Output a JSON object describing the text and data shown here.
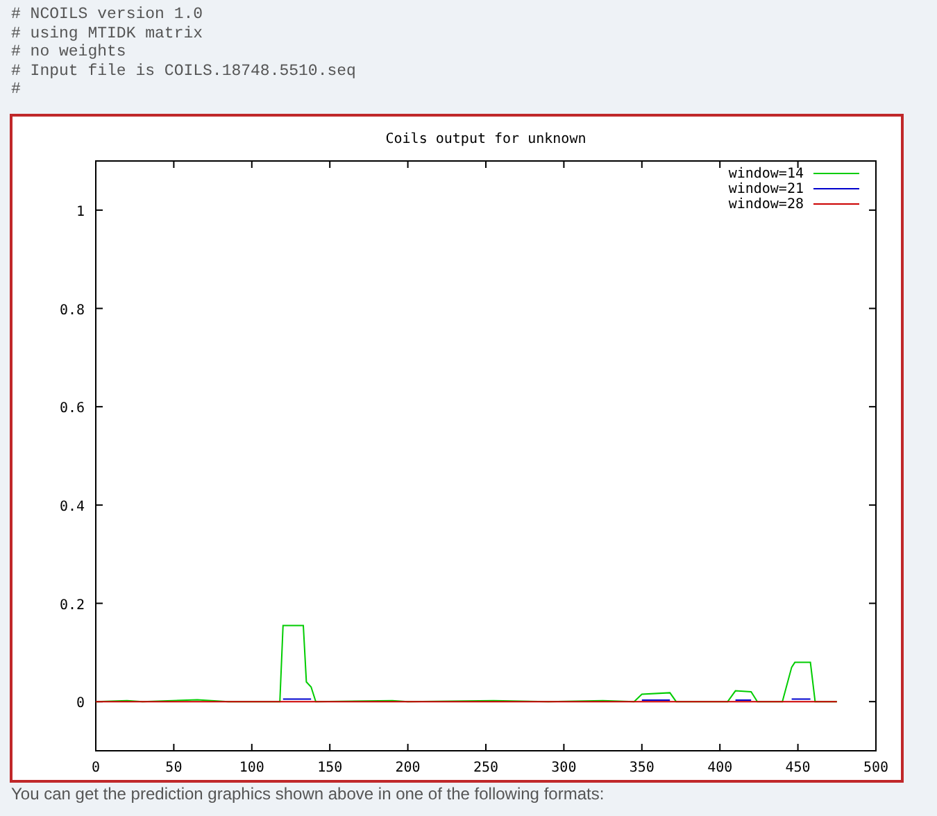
{
  "header_lines": [
    "# NCOILS version 1.0",
    "# using MTIDK matrix",
    "# no weights",
    "# Input file is COILS.18748.5510.seq",
    "#"
  ],
  "chart": {
    "chart_data": {
      "type": "line",
      "title": "Coils output for unknown",
      "x": [
        0,
        20,
        30,
        65,
        85,
        118,
        120,
        123,
        133,
        135,
        138,
        141,
        190,
        200,
        255,
        290,
        325,
        345,
        350,
        368,
        372,
        405,
        410,
        420,
        424,
        440,
        446,
        448,
        458,
        461,
        475
      ],
      "series": [
        {
          "name": "window=14",
          "color": "#00cc00",
          "values": [
            0,
            0.002,
            0,
            0.004,
            0,
            0,
            0.155,
            0.155,
            0.155,
            0.04,
            0.03,
            0,
            0.002,
            0,
            0.002,
            0,
            0.002,
            0,
            0.015,
            0.018,
            0,
            0,
            0.022,
            0.02,
            0,
            0,
            0.07,
            0.08,
            0.08,
            0,
            0
          ]
        },
        {
          "name": "window=21",
          "color": "#0000cc",
          "values": [
            null,
            null,
            null,
            null,
            null,
            null,
            0.005,
            0.005,
            0.005,
            0.005,
            0.005,
            null,
            null,
            null,
            null,
            null,
            null,
            null,
            0.003,
            0.003,
            null,
            null,
            0.003,
            0.003,
            null,
            null,
            0.005,
            0.005,
            0.005,
            null,
            null
          ]
        },
        {
          "name": "window=28",
          "color": "#cc0000",
          "values": [
            0,
            0,
            0,
            0,
            0,
            0,
            0,
            0,
            0,
            0,
            0,
            0,
            0,
            0,
            0,
            0,
            0,
            0,
            0,
            0,
            0,
            0,
            0,
            0,
            0,
            0,
            0,
            0,
            0,
            0,
            0
          ]
        }
      ],
      "legend": "top-right",
      "xlim": [
        0,
        500
      ],
      "ylim": [
        -0.1,
        1.1
      ],
      "xticks": [
        0,
        50,
        100,
        150,
        200,
        250,
        300,
        350,
        400,
        450,
        500
      ],
      "yticks": [
        0,
        0.2,
        0.4,
        0.6,
        0.8,
        1
      ]
    }
  },
  "caption": "You can get the prediction graphics shown above in one of the following formats:"
}
